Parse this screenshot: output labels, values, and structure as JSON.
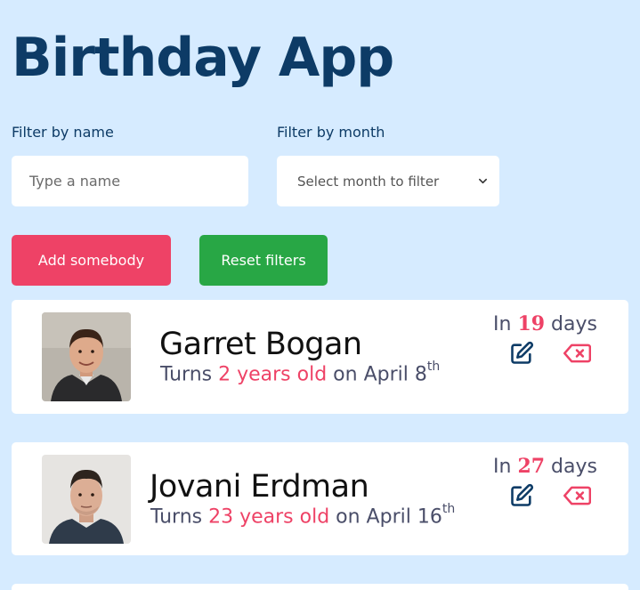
{
  "app": {
    "title": "Birthday App"
  },
  "filters": {
    "name_label": "Filter by name",
    "name_placeholder": "Type a name",
    "month_label": "Filter by month",
    "month_selected": "Select month to filter"
  },
  "actions": {
    "add_label": "Add somebody",
    "reset_label": "Reset filters"
  },
  "people": [
    {
      "name": "Garret Bogan",
      "turns_prefix": "Turns ",
      "age": "2 years old",
      "on_text": " on April 8",
      "ordinal": "th",
      "days_prefix": "In ",
      "days": "19",
      "days_suffix": " days"
    },
    {
      "name": "Jovani Erdman",
      "turns_prefix": "Turns ",
      "age": "23 years old",
      "on_text": " on April 16",
      "ordinal": "th",
      "days_prefix": "In ",
      "days": "27",
      "days_suffix": " days"
    }
  ],
  "colors": {
    "background": "#d6ebff",
    "title": "#0d3b66",
    "accent_red": "#ee4266",
    "accent_green": "#28a745",
    "text_muted": "#4a4e69"
  },
  "icons": {
    "edit": "edit-icon",
    "delete": "delete-icon",
    "select_arrow": "chevron-down-icon"
  }
}
